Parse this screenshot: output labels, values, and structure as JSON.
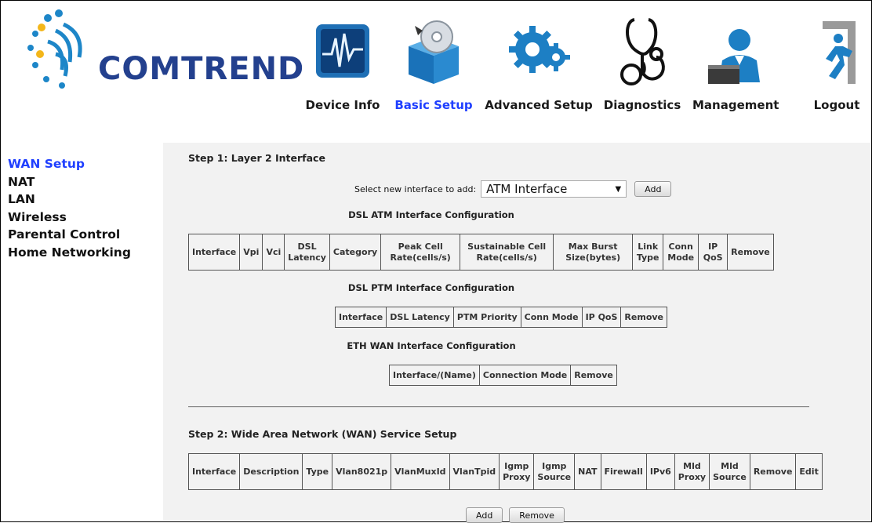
{
  "header": {
    "brand": "COMTREND",
    "nav": [
      {
        "label": "Device Info",
        "icon": "device-info-icon"
      },
      {
        "label": "Basic Setup",
        "icon": "basic-setup-icon",
        "active": true
      },
      {
        "label": "Advanced Setup",
        "icon": "advanced-setup-icon"
      },
      {
        "label": "Diagnostics",
        "icon": "diagnostics-icon"
      },
      {
        "label": "Management",
        "icon": "management-icon"
      },
      {
        "label": "Logout",
        "icon": "logout-icon"
      }
    ]
  },
  "sidebar": {
    "items": [
      {
        "label": "WAN Setup",
        "active": true
      },
      {
        "label": "NAT"
      },
      {
        "label": "LAN"
      },
      {
        "label": "Wireless"
      },
      {
        "label": "Parental Control"
      },
      {
        "label": "Home Networking"
      }
    ]
  },
  "main": {
    "step1_title": "Step 1: Layer 2 Interface",
    "select_label": "Select new interface to add:",
    "select_value": "ATM Interface",
    "add_label": "Add",
    "atm_caption": "DSL ATM Interface Configuration",
    "atm_headers": [
      "Interface",
      "Vpi",
      "Vci",
      "DSL Latency",
      "Category",
      "Peak Cell Rate(cells/s)",
      "Sustainable Cell Rate(cells/s)",
      "Max Burst Size(bytes)",
      "Link Type",
      "Conn Mode",
      "IP QoS",
      "Remove"
    ],
    "ptm_caption": "DSL PTM Interface Configuration",
    "ptm_headers": [
      "Interface",
      "DSL Latency",
      "PTM Priority",
      "Conn Mode",
      "IP QoS",
      "Remove"
    ],
    "eth_caption": "ETH WAN Interface Configuration",
    "eth_headers": [
      "Interface/(Name)",
      "Connection Mode",
      "Remove"
    ],
    "step2_title": "Step 2: Wide Area Network (WAN) Service Setup",
    "wan_headers": [
      "Interface",
      "Description",
      "Type",
      "Vlan8021p",
      "VlanMuxId",
      "VlanTpid",
      "Igmp Proxy",
      "Igmp Source",
      "NAT",
      "Firewall",
      "IPv6",
      "Mld Proxy",
      "Mld Source",
      "Remove",
      "Edit"
    ],
    "bottom_add_label": "Add",
    "bottom_remove_label": "Remove"
  },
  "colors": {
    "active": "#1f3fff",
    "brand": "#23408e",
    "icon_blue": "#1d86c8",
    "sidebar_bg": "#ffffff",
    "content_bg": "#f2f2f2"
  }
}
